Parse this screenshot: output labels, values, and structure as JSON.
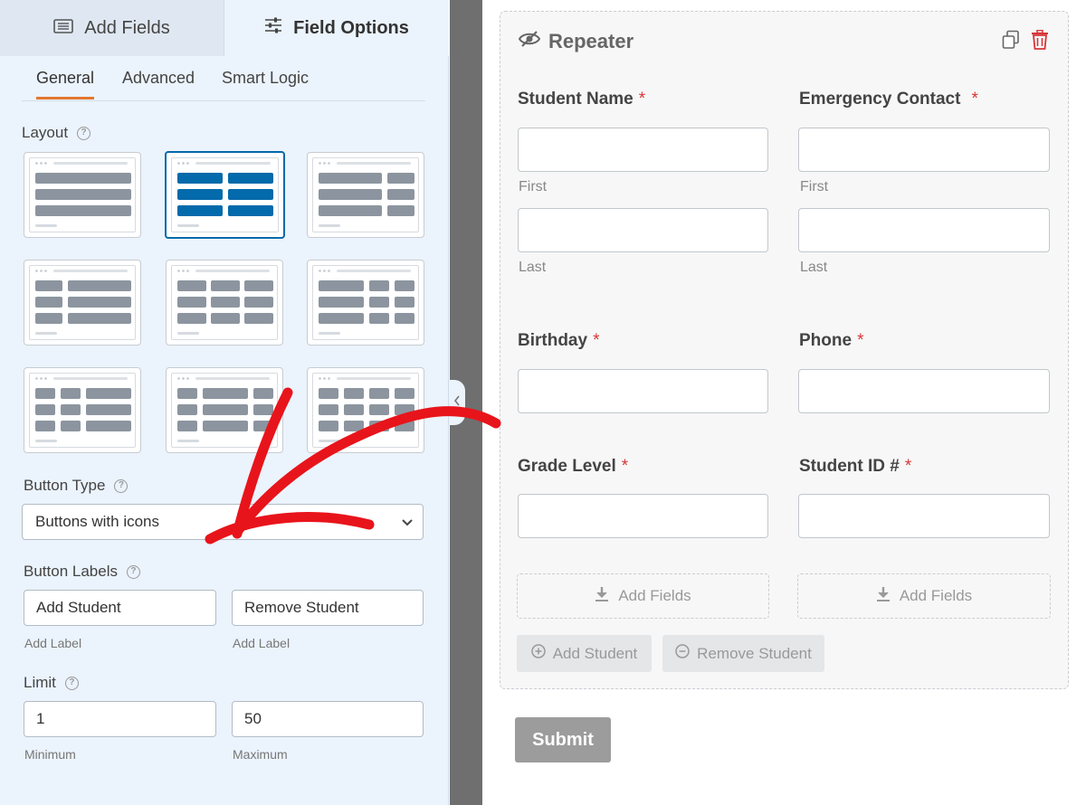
{
  "panel": {
    "tabs": {
      "add_fields": "Add Fields",
      "field_options": "Field Options"
    },
    "sub_tabs": {
      "general": "General",
      "advanced": "Advanced",
      "smart_logic": "Smart Logic"
    },
    "layout_label": "Layout",
    "button_type_label": "Button Type",
    "button_type_value": "Buttons with icons",
    "button_labels_label": "Button Labels",
    "add_label_value": "Add Student",
    "remove_label_value": "Remove Student",
    "add_label_caption": "Add Label",
    "remove_label_caption": "Add Label",
    "limit_label": "Limit",
    "limit_min": "1",
    "limit_max": "50",
    "min_caption": "Minimum",
    "max_caption": "Maximum"
  },
  "preview": {
    "repeater_title": "Repeater",
    "required_mark": "*",
    "fields": {
      "student_name": "Student Name",
      "emergency_contact": "Emergency Contact",
      "first": "First",
      "last": "Last",
      "birthday": "Birthday",
      "phone": "Phone",
      "grade_level": "Grade Level",
      "student_id": "Student ID #"
    },
    "add_fields_label": "Add Fields",
    "add_student_button": "Add Student",
    "remove_student_button": "Remove Student",
    "submit_button": "Submit"
  },
  "colors": {
    "accent_tab": "#e27730",
    "selected_layout": "#036aab",
    "required": "#d63638",
    "arrow": "#e8141b"
  }
}
